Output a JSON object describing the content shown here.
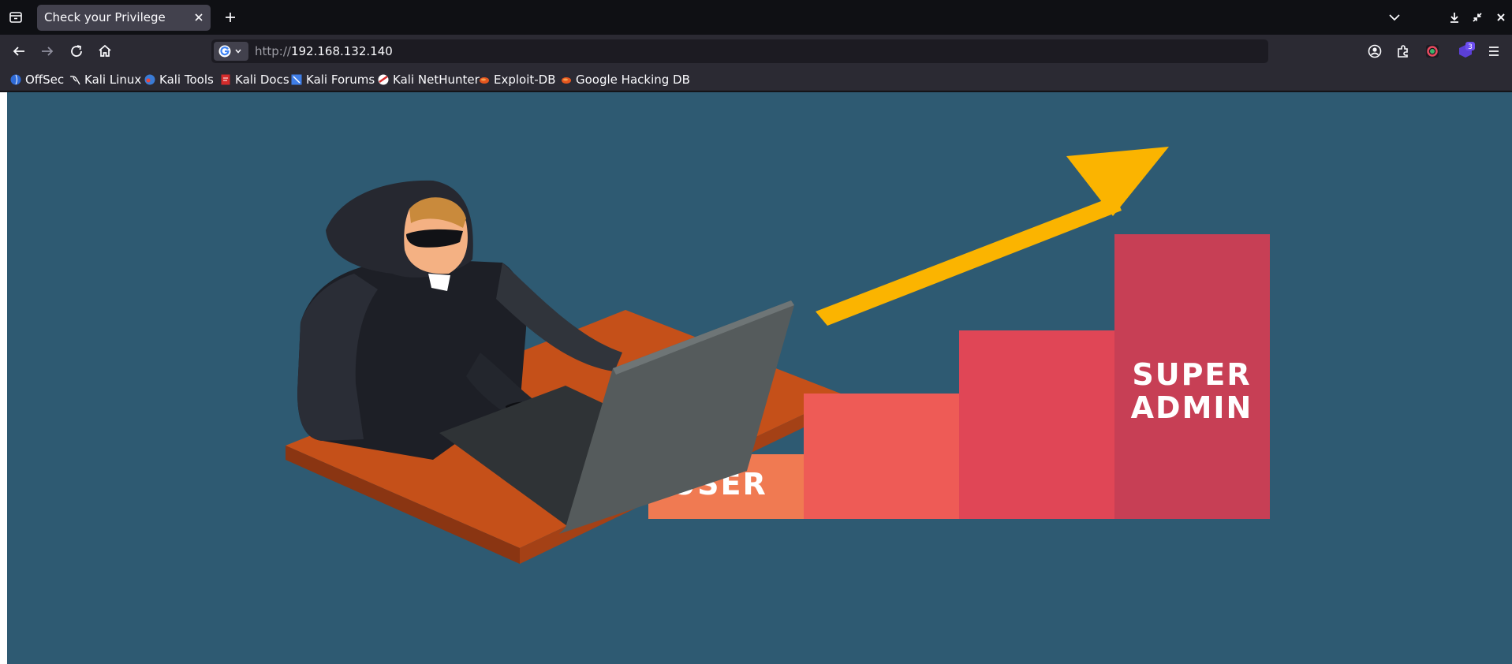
{
  "browser": {
    "tab": {
      "title": "Check your Privilege"
    },
    "url": {
      "protocol": "http://",
      "host": "192.168.132.140"
    },
    "extensions_badge": "3",
    "bookmarks": [
      "OffSec",
      "Kali Linux",
      "Kali Tools",
      "Kali Docs",
      "Kali Forums",
      "Kali NetHunter",
      "Exploit-DB",
      "Google Hacking DB"
    ]
  },
  "page": {
    "steps": {
      "user_label": "USER",
      "super_label_line1": "SUPER",
      "super_label_line2": "ADMIN"
    },
    "colors": {
      "background": "#2e5a72",
      "arrow": "#fbb400",
      "step1": "#f07a52",
      "step2": "#ee5b56",
      "step3": "#e04656",
      "step4": "#c73f55",
      "desk": "#c55019"
    }
  }
}
